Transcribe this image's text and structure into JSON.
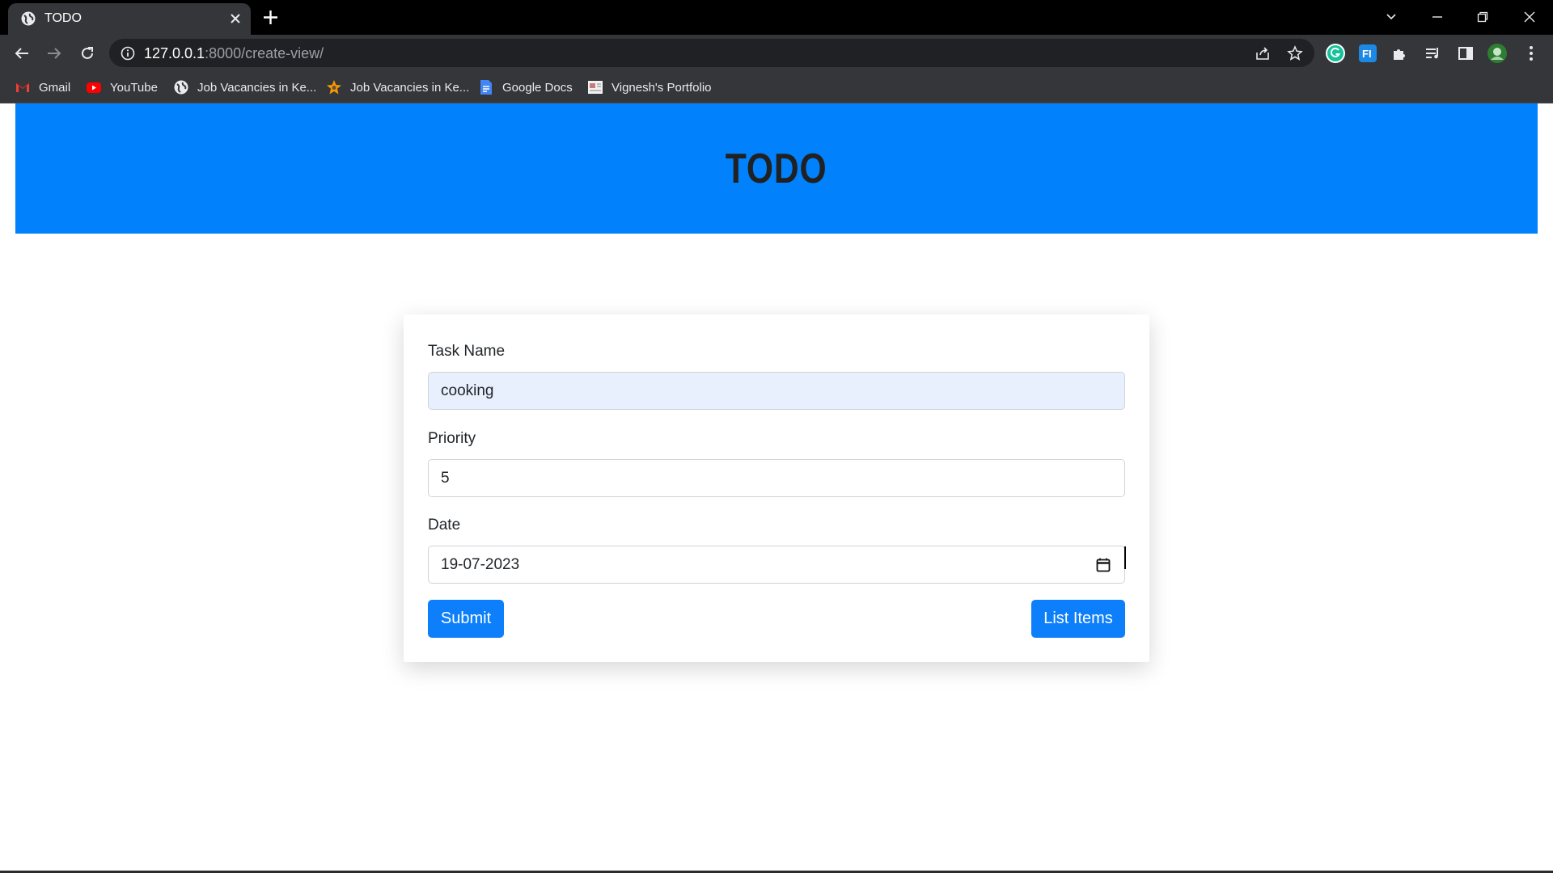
{
  "browser": {
    "tab_title": "TODO",
    "url_host": "127.0.0.1",
    "url_rest": ":8000/create-view/",
    "bookmarks": [
      {
        "label": "Gmail",
        "icon": "gmail-icon"
      },
      {
        "label": "YouTube",
        "icon": "youtube-icon"
      },
      {
        "label": "Job Vacancies in Ke...",
        "icon": "globe-icon"
      },
      {
        "label": "Job Vacancies in Ke...",
        "icon": "star-logo-icon"
      },
      {
        "label": "Google Docs",
        "icon": "docs-icon"
      },
      {
        "label": "Vignesh's Portfolio",
        "icon": "portfolio-icon"
      }
    ]
  },
  "header": {
    "title": "TODO",
    "background_color": "#0181fb"
  },
  "form": {
    "task_label": "Task Name",
    "task_value": "cooking",
    "priority_label": "Priority",
    "priority_value": "5",
    "date_label": "Date",
    "date_value": "19-07-2023",
    "submit_label": "Submit",
    "list_label": "List Items",
    "button_color": "#0d7ffb"
  }
}
